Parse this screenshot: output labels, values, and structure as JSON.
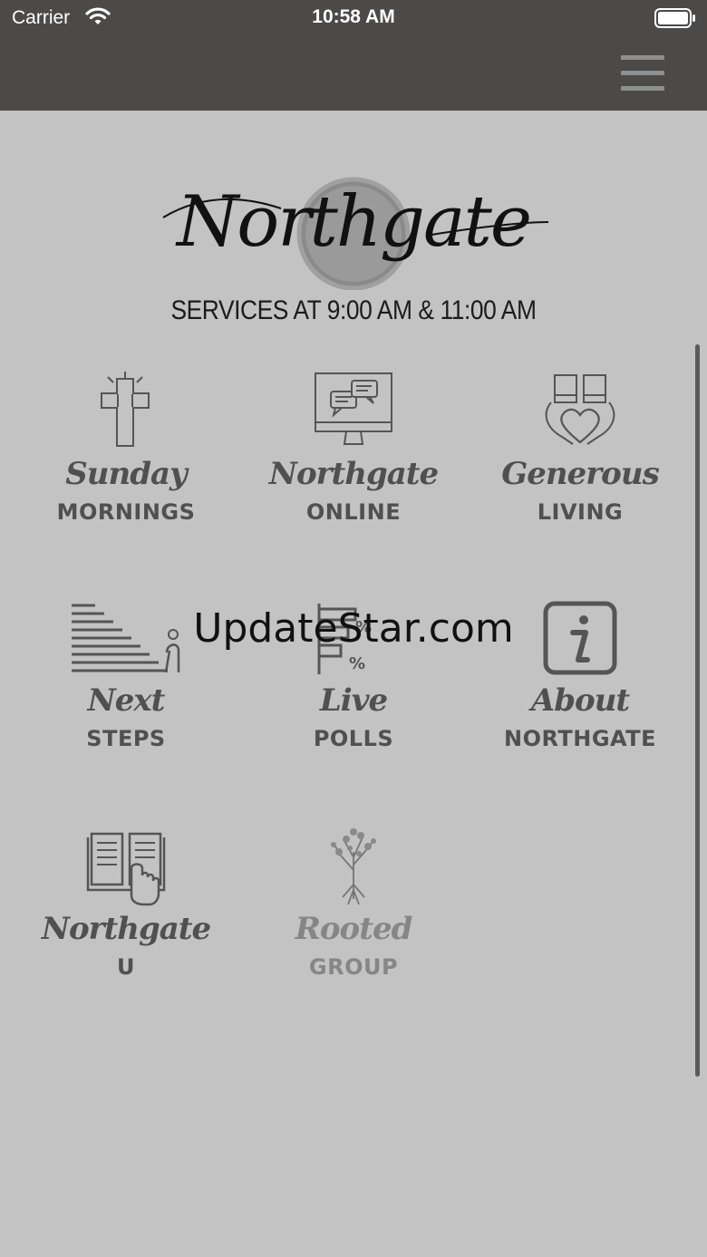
{
  "status_bar": {
    "carrier": "Carrier",
    "time": "10:58 AM"
  },
  "nav": {
    "menu_icon": "hamburger-menu-icon"
  },
  "header": {
    "logo_text": "Northgate",
    "services": "SERVICES AT 9:00 AM & 11:00 AM"
  },
  "tiles": [
    {
      "script": "Sunday",
      "caps": "MORNINGS",
      "icon": "cross-icon"
    },
    {
      "script": "Northgate",
      "caps": "ONLINE",
      "icon": "monitor-chat-icon"
    },
    {
      "script": "Generous",
      "caps": "LIVING",
      "icon": "hands-heart-icon"
    },
    {
      "script": "Next",
      "caps": "STEPS",
      "icon": "stairs-person-icon"
    },
    {
      "script": "Live",
      "caps": "POLLS",
      "icon": "poll-bars-icon"
    },
    {
      "script": "About",
      "caps": "NORTHGATE",
      "icon": "info-icon"
    },
    {
      "script": "Northgate",
      "caps": "U",
      "icon": "book-hand-icon"
    },
    {
      "script": "Rooted",
      "caps": "GROUP",
      "icon": "tree-roots-icon"
    }
  ],
  "watermark": "UpdateStar.com"
}
